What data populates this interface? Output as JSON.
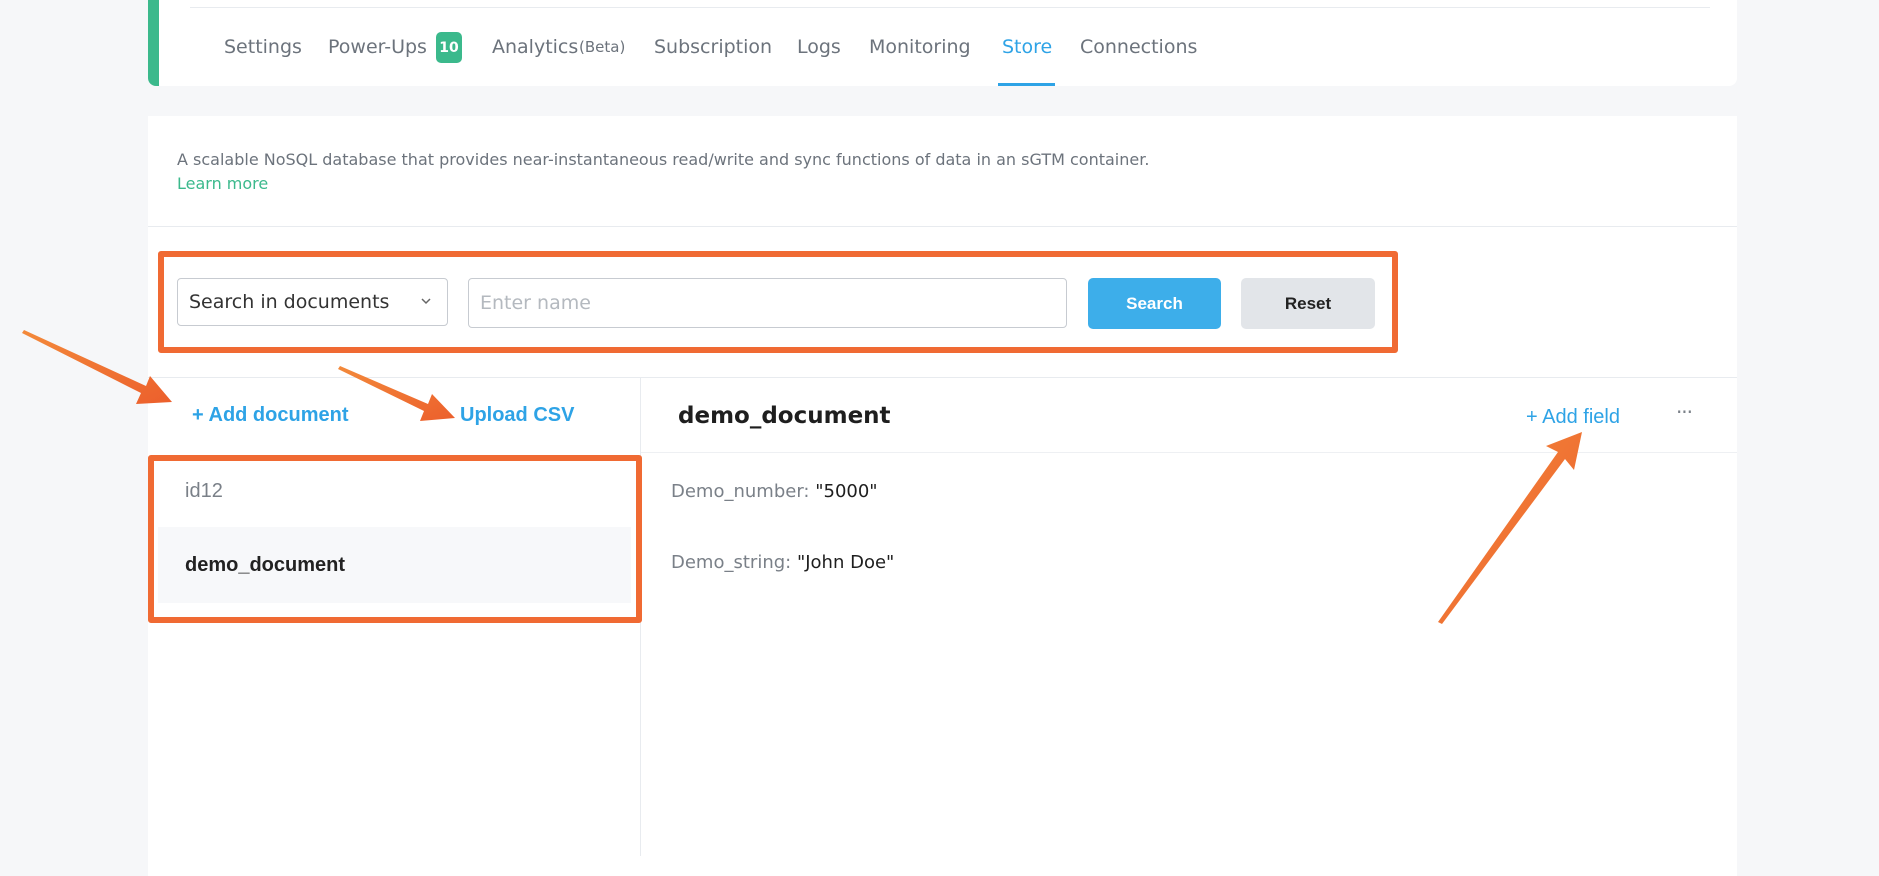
{
  "nav": {
    "tabs": [
      {
        "label": "Settings"
      },
      {
        "label": "Power-Ups",
        "badge": "10"
      },
      {
        "label": "Analytics",
        "suffix": "(Beta)"
      },
      {
        "label": "Subscription"
      },
      {
        "label": "Logs"
      },
      {
        "label": "Monitoring"
      },
      {
        "label": "Store",
        "active": true
      },
      {
        "label": "Connections"
      }
    ]
  },
  "store": {
    "description": "A scalable NoSQL database that provides near-instantaneous read/write and sync functions of data in an sGTM container.",
    "learn_more": "Learn more"
  },
  "search": {
    "scope": "Search in documents",
    "placeholder": "Enter name",
    "search_label": "Search",
    "reset_label": "Reset"
  },
  "documents": {
    "add_label": "+ Add document",
    "upload_label": "Upload CSV",
    "items": [
      {
        "name": "id12",
        "selected": false
      },
      {
        "name": "demo_document",
        "selected": true
      }
    ]
  },
  "detail": {
    "title": "demo_document",
    "add_field_label": "+ Add field",
    "more_label": "···",
    "fields": [
      {
        "key": "Demo_number:",
        "value": "\"5000\""
      },
      {
        "key": "Demo_string:",
        "value": "\"John Doe\""
      }
    ]
  },
  "colors": {
    "accent_blue": "#2ea3e6",
    "accent_green": "#3bb98c",
    "annotation_orange": "#f06a33"
  }
}
